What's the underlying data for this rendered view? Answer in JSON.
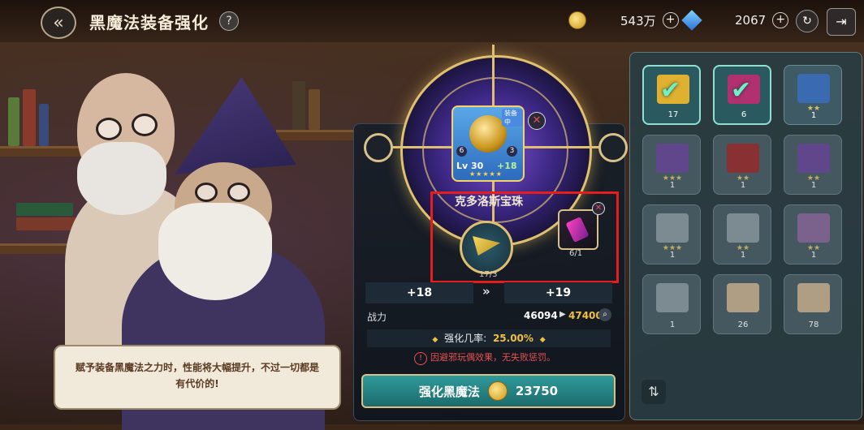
{
  "header": {
    "title": "黑魔法装备强化",
    "help_label": "?",
    "gold": "543万",
    "gems": "2067",
    "plus": "+"
  },
  "dialog": {
    "text_line1": "赋予装备黑魔法之力时，性能将大幅提升，不过一切都是",
    "text_line2": "有代价的!"
  },
  "equipment": {
    "badge": "装备中",
    "level": "Lv 30",
    "plus_level": "+18",
    "stars": "★★★★★",
    "left_num": "6",
    "right_num": "3",
    "name": "克多洛斯宝珠"
  },
  "materials": {
    "primary_count": "17/3",
    "secondary_count": "6/1"
  },
  "upgrade": {
    "from_level": "+18",
    "to_level": "+19",
    "arrow": "»",
    "power_label": "战力",
    "power_old": "46094",
    "power_arrow": "▶",
    "power_new": "47400",
    "rate_label": "强化几率:",
    "rate_value": "25.00%",
    "rate_diamond": "◆",
    "warning": "因避邪玩偶效果，无失败惩罚。",
    "warn_icon": "!",
    "button_label": "强化黑魔法",
    "cost": "23750"
  },
  "inventory": [
    {
      "count": "17",
      "stars": "",
      "selected": true,
      "color": "#e0b030"
    },
    {
      "count": "6",
      "stars": "",
      "selected": true,
      "color": "#b03070"
    },
    {
      "count": "1",
      "stars": "★★",
      "selected": false,
      "color": "#3a6ab0"
    },
    {
      "count": "1",
      "stars": "★★★",
      "selected": false,
      "color": "#6a4a9a"
    },
    {
      "count": "1",
      "stars": "★★",
      "selected": false,
      "color": "#9a3030"
    },
    {
      "count": "1",
      "stars": "★★",
      "selected": false,
      "color": "#6a4a9a"
    },
    {
      "count": "1",
      "stars": "★★★",
      "selected": false,
      "color": "#8a9aa0"
    },
    {
      "count": "1",
      "stars": "★★",
      "selected": false,
      "color": "#8a9aa0"
    },
    {
      "count": "1",
      "stars": "★★",
      "selected": false,
      "color": "#8a6a9a"
    },
    {
      "count": "1",
      "stars": "",
      "selected": false,
      "color": "#8a9aa0"
    },
    {
      "count": "26",
      "stars": "",
      "selected": false,
      "color": "#c8b090"
    },
    {
      "count": "78",
      "stars": "",
      "selected": false,
      "color": "#c8b090"
    }
  ],
  "colors": {
    "accent_gold": "#e0c070",
    "highlight_red": "#e51d1d",
    "button_teal": "#2f9a9a"
  }
}
